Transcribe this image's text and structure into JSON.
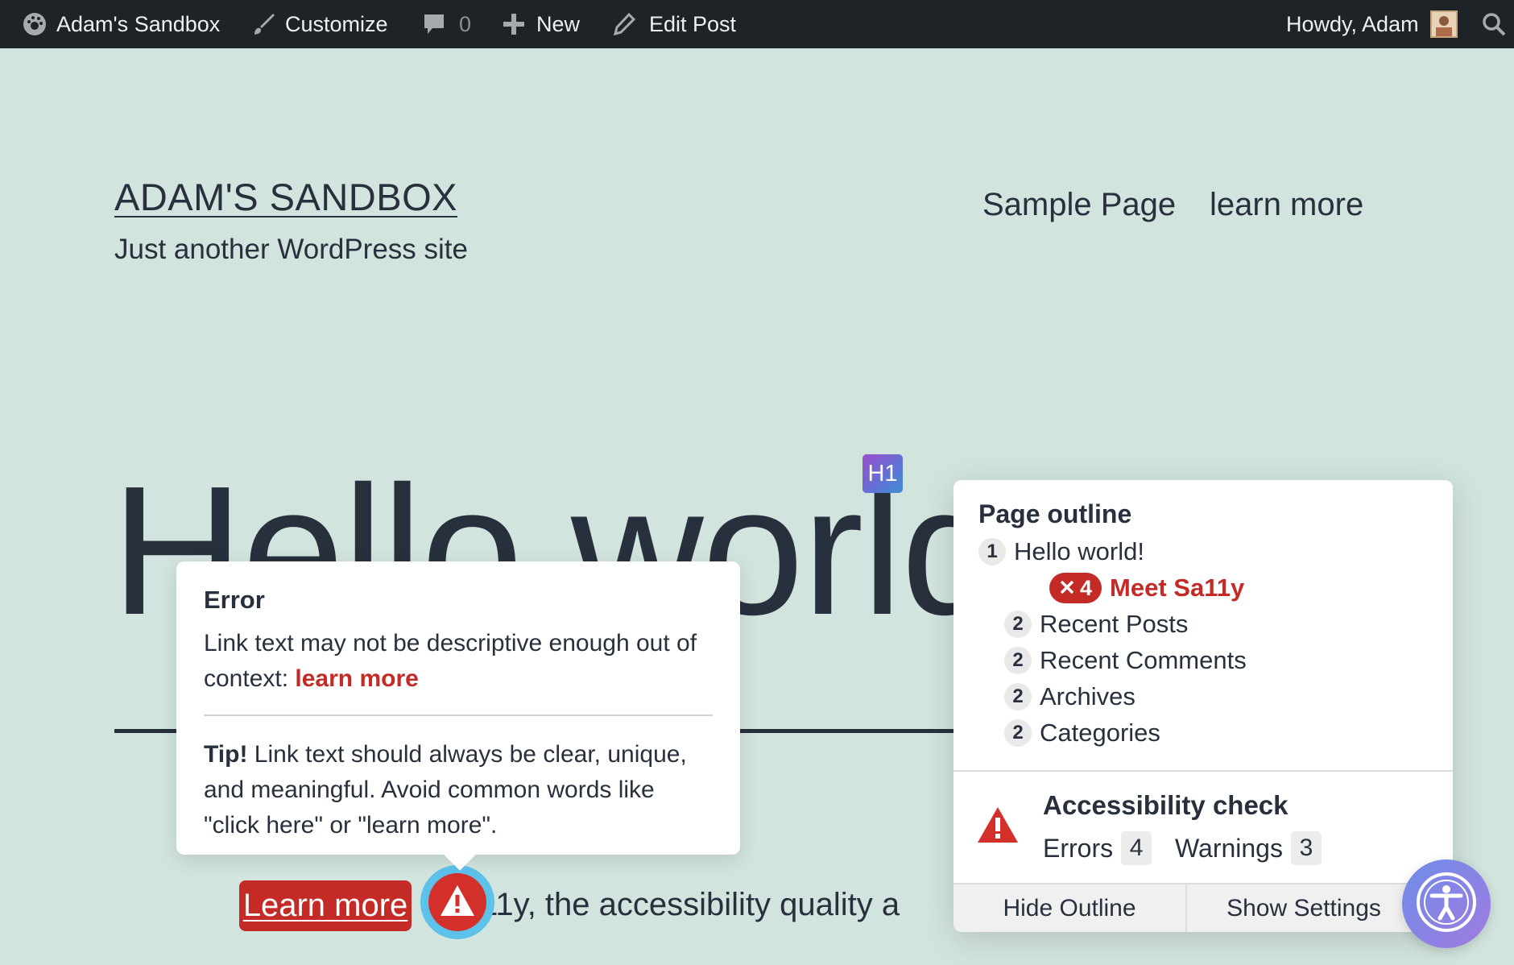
{
  "admin_bar": {
    "site_name": "Adam's Sandbox",
    "customize": "Customize",
    "comments_count": "0",
    "new": "New",
    "edit_post": "Edit Post",
    "howdy": "Howdy, Adam",
    "icons": [
      "dashboard-icon",
      "brush-icon",
      "comment-icon",
      "plus-icon",
      "pencil-icon",
      "avatar",
      "search-icon"
    ]
  },
  "site": {
    "title": "ADAM'S SANDBOX",
    "description": "Just another WordPress site",
    "nav": [
      "Sample Page",
      "learn more"
    ]
  },
  "post": {
    "heading": "Hello world!",
    "heading_badge": "H1",
    "link_text": "Learn more",
    "paragraph_rest": "t Sa11y, the accessibility quality a"
  },
  "tooltip": {
    "title": "Error",
    "message": "Link text may not be descriptive enough out of context:",
    "flagged_text": "learn more",
    "tip_label": "Tip!",
    "tip_text": "Link text should always be clear, unique, and meaningful. Avoid common words like \"click here\" or \"learn more\"."
  },
  "outline": {
    "title": "Page outline",
    "items": [
      {
        "level": "1",
        "text": "Hello world!"
      },
      {
        "error_count": "4",
        "text": "Meet Sa11y"
      },
      {
        "level": "2",
        "text": "Recent Posts"
      },
      {
        "level": "2",
        "text": "Recent Comments"
      },
      {
        "level": "2",
        "text": "Archives"
      },
      {
        "level": "2",
        "text": "Categories"
      }
    ]
  },
  "check": {
    "title": "Accessibility check",
    "errors_label": "Errors",
    "errors_count": "4",
    "warnings_label": "Warnings",
    "warnings_count": "3",
    "hide_outline": "Hide Outline",
    "show_settings": "Show Settings"
  },
  "colors": {
    "page_bg": "#d1e4dd",
    "admin_bar": "#1d2327",
    "error_red": "#c52b26",
    "text": "#28303d"
  }
}
